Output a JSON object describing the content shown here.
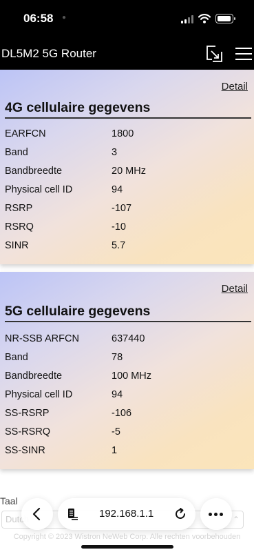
{
  "status_bar": {
    "time": "06:58"
  },
  "header": {
    "title": "DL5M2 5G Router"
  },
  "card_4g": {
    "detail_label": "Detail",
    "title": "4G cellulaire gegevens",
    "rows": [
      {
        "label": "EARFCN",
        "value": "1800"
      },
      {
        "label": "Band",
        "value": "3"
      },
      {
        "label": "Bandbreedte",
        "value": "20 MHz"
      },
      {
        "label": "Physical cell ID",
        "value": "94"
      },
      {
        "label": "RSRP",
        "value": "-107"
      },
      {
        "label": "RSRQ",
        "value": "-10"
      },
      {
        "label": "SINR",
        "value": "5.7"
      }
    ]
  },
  "card_5g": {
    "detail_label": "Detail",
    "title": "5G cellulaire gegevens",
    "rows": [
      {
        "label": "NR-SSB ARFCN",
        "value": "637440"
      },
      {
        "label": "Band",
        "value": "78"
      },
      {
        "label": "Bandbreedte",
        "value": "100 MHz"
      },
      {
        "label": "Physical cell ID",
        "value": "94"
      },
      {
        "label": "SS-RSRP",
        "value": "-106"
      },
      {
        "label": "SS-RSRQ",
        "value": "-5"
      },
      {
        "label": "SS-SINR",
        "value": "1"
      }
    ]
  },
  "footer": {
    "language_label": "Taal",
    "language_value": "Dutch",
    "copyright": "Copyright © 2023 Wistron NeWeb Corp. Alle rechten voorbehouden"
  },
  "browser": {
    "url": "192.168.1.1"
  },
  "colors": {
    "header_bg": "#000000",
    "card_gradient_start": "#bcc4f6",
    "card_gradient_end": "#fbe5ba"
  }
}
